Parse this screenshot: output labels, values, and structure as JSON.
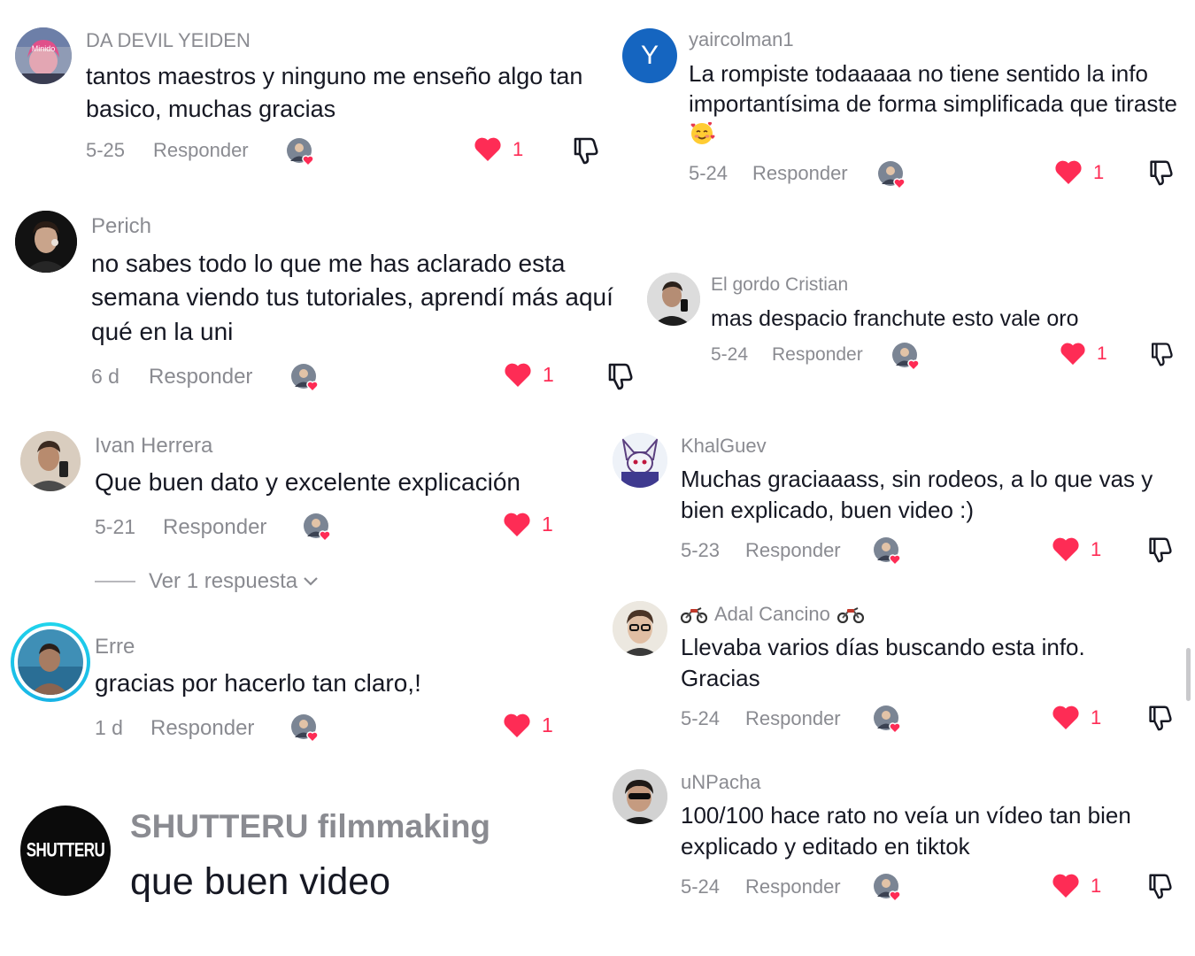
{
  "actions": {
    "reply_label": "Responder"
  },
  "comments": [
    {
      "username": "DA DEVIL YEIDEN",
      "text": "tantos maestros y ninguno me enseño algo tan basico, muchas gracias",
      "date": "5-25",
      "likes": "1",
      "avatar_text": "Minido"
    },
    {
      "username": "Perich",
      "text": "no sabes todo lo que me has aclarado esta semana viendo tus tutoriales, aprendí más aquí qué en la uni",
      "date": "6 d",
      "likes": "1"
    },
    {
      "username": "Ivan Herrera",
      "text": "Que buen dato y excelente explicación",
      "date": "5-21",
      "likes": "1"
    },
    {
      "username": "Erre",
      "text": "gracias por hacerlo tan claro,!",
      "date": "1 d",
      "likes": "1"
    },
    {
      "username": "SHUTTERU filmmaking",
      "text": "que buen video",
      "avatar_text": "SHUTTERU"
    },
    {
      "username": "yaircolman1",
      "text": "La rompiste todaaaaa no tiene sentido la info importantísima de forma simplificada que tiraste",
      "emoji": "smiling-face-with-hearts",
      "date": "5-24",
      "likes": "1",
      "avatar_letter": "Y"
    },
    {
      "username": "El gordo Cristian",
      "text": "mas despacio franchute esto vale oro",
      "date": "5-24",
      "likes": "1"
    },
    {
      "username": "KhalGuev",
      "text": "Muchas graciaaass, sin rodeos, a lo que vas y bien explicado, buen video :)",
      "date": "5-23",
      "likes": "1"
    },
    {
      "username": "Adal Cancino",
      "username_icon": "motorcycle-icon",
      "text": "Llevaba varios días buscando esta info. Gracias",
      "date": "5-24",
      "likes": "1"
    },
    {
      "username": "uNPacha",
      "text": "100/100 hace rato no veía un vídeo tan bien explicado y editado en tiktok",
      "date": "5-24",
      "likes": "1"
    }
  ],
  "replies_toggle": {
    "label": "Ver 1 respuesta"
  },
  "colors": {
    "like": "#fe2c55",
    "muted_text": "#8a8b91",
    "body_text": "#161823",
    "avatar_blue": "#1565c0",
    "story_ring": "#20d5ec"
  }
}
